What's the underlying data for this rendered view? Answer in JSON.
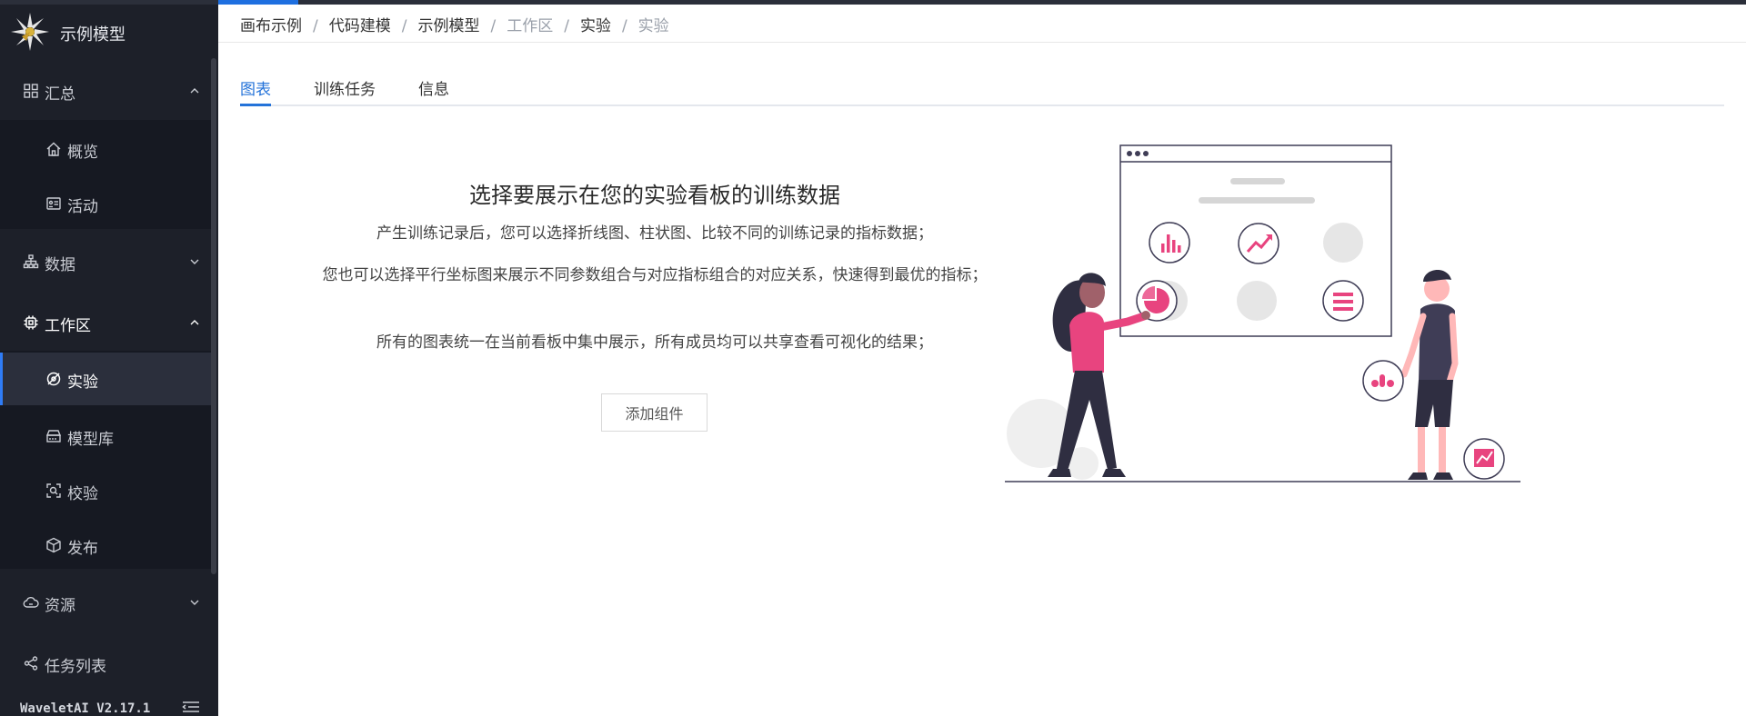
{
  "app": {
    "title": "示例模型",
    "version": "WaveletAI V2.17.1"
  },
  "sidebar": {
    "groups": [
      {
        "label": "汇总",
        "icon": "grid-icon",
        "expanded": true,
        "items": [
          {
            "label": "概览",
            "icon": "home-icon"
          },
          {
            "label": "活动",
            "icon": "id-card-icon"
          }
        ]
      },
      {
        "label": "数据",
        "icon": "sitemap-icon",
        "expanded": false
      },
      {
        "label": "工作区",
        "icon": "cpu-icon",
        "expanded": true,
        "items": [
          {
            "label": "实验",
            "icon": "experiment-icon",
            "active": true
          },
          {
            "label": "模型库",
            "icon": "storage-icon"
          },
          {
            "label": "校验",
            "icon": "scan-icon"
          },
          {
            "label": "发布",
            "icon": "box-icon"
          }
        ]
      },
      {
        "label": "资源",
        "icon": "cloud-icon",
        "expanded": false
      },
      {
        "label": "任务列表",
        "icon": "share-nodes-icon"
      }
    ]
  },
  "breadcrumb": [
    "画布示例",
    "代码建模",
    "示例模型",
    "工作区",
    "实验",
    "实验"
  ],
  "tabs": [
    "图表",
    "训练任务",
    "信息"
  ],
  "empty": {
    "title": "选择要展示在您的实验看板的训练数据",
    "line1": "产生训练记录后，您可以选择折线图、柱状图、比较不同的训练记录的指标数据；",
    "line2": "您也可以选择平行坐标图来展示不同参数组合与对应指标组合的对应关系，快速得到最优的指标；",
    "line3": "所有的图表统一在当前看板中集中展示，所有成员均可以共享查看可视化的结果；",
    "button": "添加组件"
  },
  "colors": {
    "accent": "#2473d9",
    "illustration_pink": "#e8447f",
    "sidebar_bg": "#1d2029"
  }
}
